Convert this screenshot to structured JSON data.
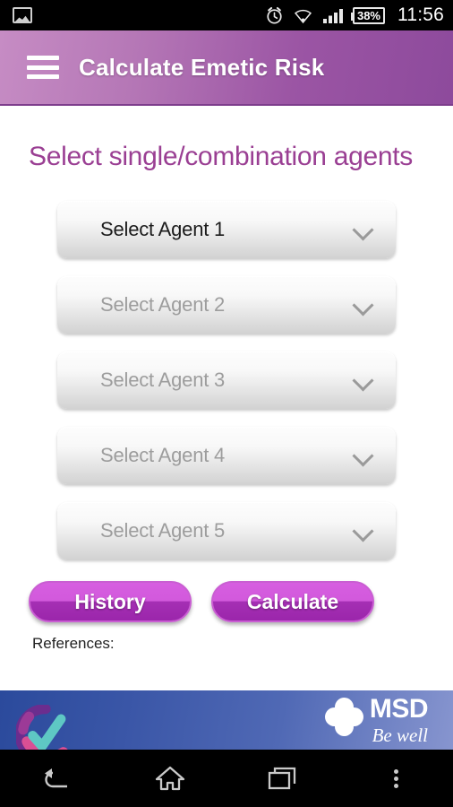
{
  "status_bar": {
    "gallery_icon": "image-icon",
    "alarm_icon": "alarm-clock-icon",
    "wifi_icon": "wifi-icon",
    "signal_icon": "signal-bars-icon",
    "battery_text": "38%",
    "time": "11:56"
  },
  "app_bar": {
    "menu_icon": "hamburger-menu-icon",
    "title": "Calculate Emetic Risk",
    "bg_gradient_from": "#c68cc4",
    "bg_gradient_to": "#8d4a9c"
  },
  "main": {
    "page_title": "Select single/combination agents",
    "title_color": "#9a3f93",
    "agents": [
      {
        "label": "Select Agent 1",
        "enabled": true,
        "chevron": "chevron-down-icon"
      },
      {
        "label": "Select Agent 2",
        "enabled": false,
        "chevron": "chevron-down-icon"
      },
      {
        "label": "Select Agent 3",
        "enabled": false,
        "chevron": "chevron-down-icon"
      },
      {
        "label": "Select Agent 4",
        "enabled": false,
        "chevron": "chevron-down-icon"
      },
      {
        "label": "Select Agent 5",
        "enabled": false,
        "chevron": "chevron-down-icon"
      }
    ],
    "buttons": {
      "history_label": "History",
      "calculate_label": "Calculate",
      "button_color_top": "#d259dc",
      "button_color_bottom": "#9b26ab"
    },
    "references_label": "References:"
  },
  "banner": {
    "brand": "MSD",
    "tagline": "Be well",
    "logo_icon": "msd-clover-icon",
    "app_logo_icon": "check-circle-logo-icon",
    "bg_gradient_from": "#2b4a9c",
    "bg_gradient_to": "#8795cf"
  },
  "nav_bar": {
    "back_icon": "back-arrow-icon",
    "home_icon": "home-icon",
    "recents_icon": "recent-apps-icon",
    "overflow_icon": "overflow-menu-icon"
  }
}
